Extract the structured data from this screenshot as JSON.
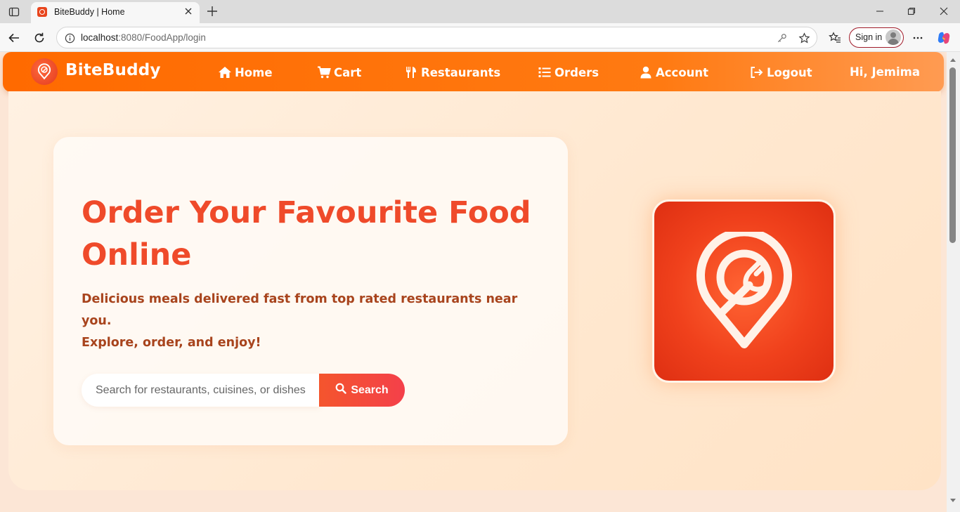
{
  "browser": {
    "tab_title": "BiteBuddy | Home",
    "url_host": "localhost",
    "url_rest": ":8080/FoodApp/login",
    "signin_label": "Sign in"
  },
  "nav": {
    "brand": "BiteBuddy",
    "links": [
      {
        "label": "Home",
        "icon": "home-icon"
      },
      {
        "label": "Cart",
        "icon": "cart-icon"
      },
      {
        "label": "Restaurants",
        "icon": "utensils-icon"
      },
      {
        "label": "Orders",
        "icon": "list-icon"
      },
      {
        "label": "Account",
        "icon": "user-icon"
      },
      {
        "label": "Logout",
        "icon": "logout-icon"
      }
    ],
    "greeting": "Hi, Jemima"
  },
  "hero": {
    "title": "Order Your Favourite Food Online",
    "subtitle_line1": "Delicious meals delivered fast from top rated restaurants near you.",
    "subtitle_line2": "Explore, order, and enjoy!",
    "search_placeholder": "Search for restaurants, cuisines, or dishes",
    "search_button": "Search"
  },
  "colors": {
    "nav_orange": "#ff6a00",
    "accent_red": "#ef4a2a",
    "subtitle_brown": "#a8441d",
    "page_bg": "#ffe8d0"
  }
}
